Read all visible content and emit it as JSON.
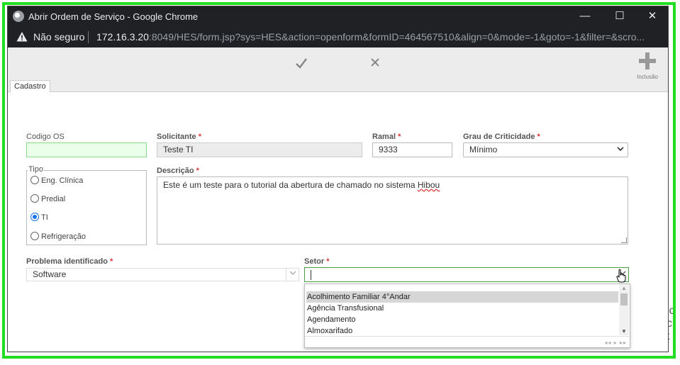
{
  "window": {
    "title": "Abrir Ordem de Serviço - Google Chrome",
    "minimize": "—",
    "maximize": "☐",
    "close": "✕"
  },
  "address": {
    "security_label": "Não seguro",
    "url_host": "172.16.3.20",
    "url_rest": ":8049/HES/form.jsp?sys=HES&action=openform&formID=464567510&align=0&mode=-1&goto=-1&filter=&scro..."
  },
  "toolbar": {
    "confirm_icon": "check-icon",
    "cancel_icon": "close-icon",
    "add_label": "Inclusão"
  },
  "tabs": [
    {
      "label": "Cadastro"
    }
  ],
  "form": {
    "codigo_os": {
      "label": "Codigo OS",
      "value": ""
    },
    "solicitante": {
      "label": "Solicitante",
      "value": "Teste TI"
    },
    "ramal": {
      "label": "Ramal",
      "value": "9333"
    },
    "grau": {
      "label": "Grau de Criticidade",
      "value": "Mínimo"
    },
    "tipo": {
      "label": "Tipo",
      "options": [
        {
          "label": "Eng. Clínica",
          "checked": false
        },
        {
          "label": "Predial",
          "checked": false
        },
        {
          "label": "TI",
          "checked": true
        },
        {
          "label": "Refrigeração",
          "checked": false
        }
      ]
    },
    "descricao": {
      "label": "Descrição",
      "value_main": "Este é um teste para o tutorial da abertura de chamado no sistema ",
      "value_misspelled": "Hibou"
    },
    "problema": {
      "label": "Problema identificado",
      "value": "Software"
    },
    "setor": {
      "label": "Setor",
      "value": "",
      "options": [
        "Acolhimento Familiar 4°Andar",
        "Agência Transfusional",
        "Agendamento",
        "Almoxarifado"
      ],
      "highlighted_index": 0
    },
    "required_marker": "*"
  },
  "colors": {
    "highlight": "#22dd22",
    "accent": "#1a73e8"
  }
}
